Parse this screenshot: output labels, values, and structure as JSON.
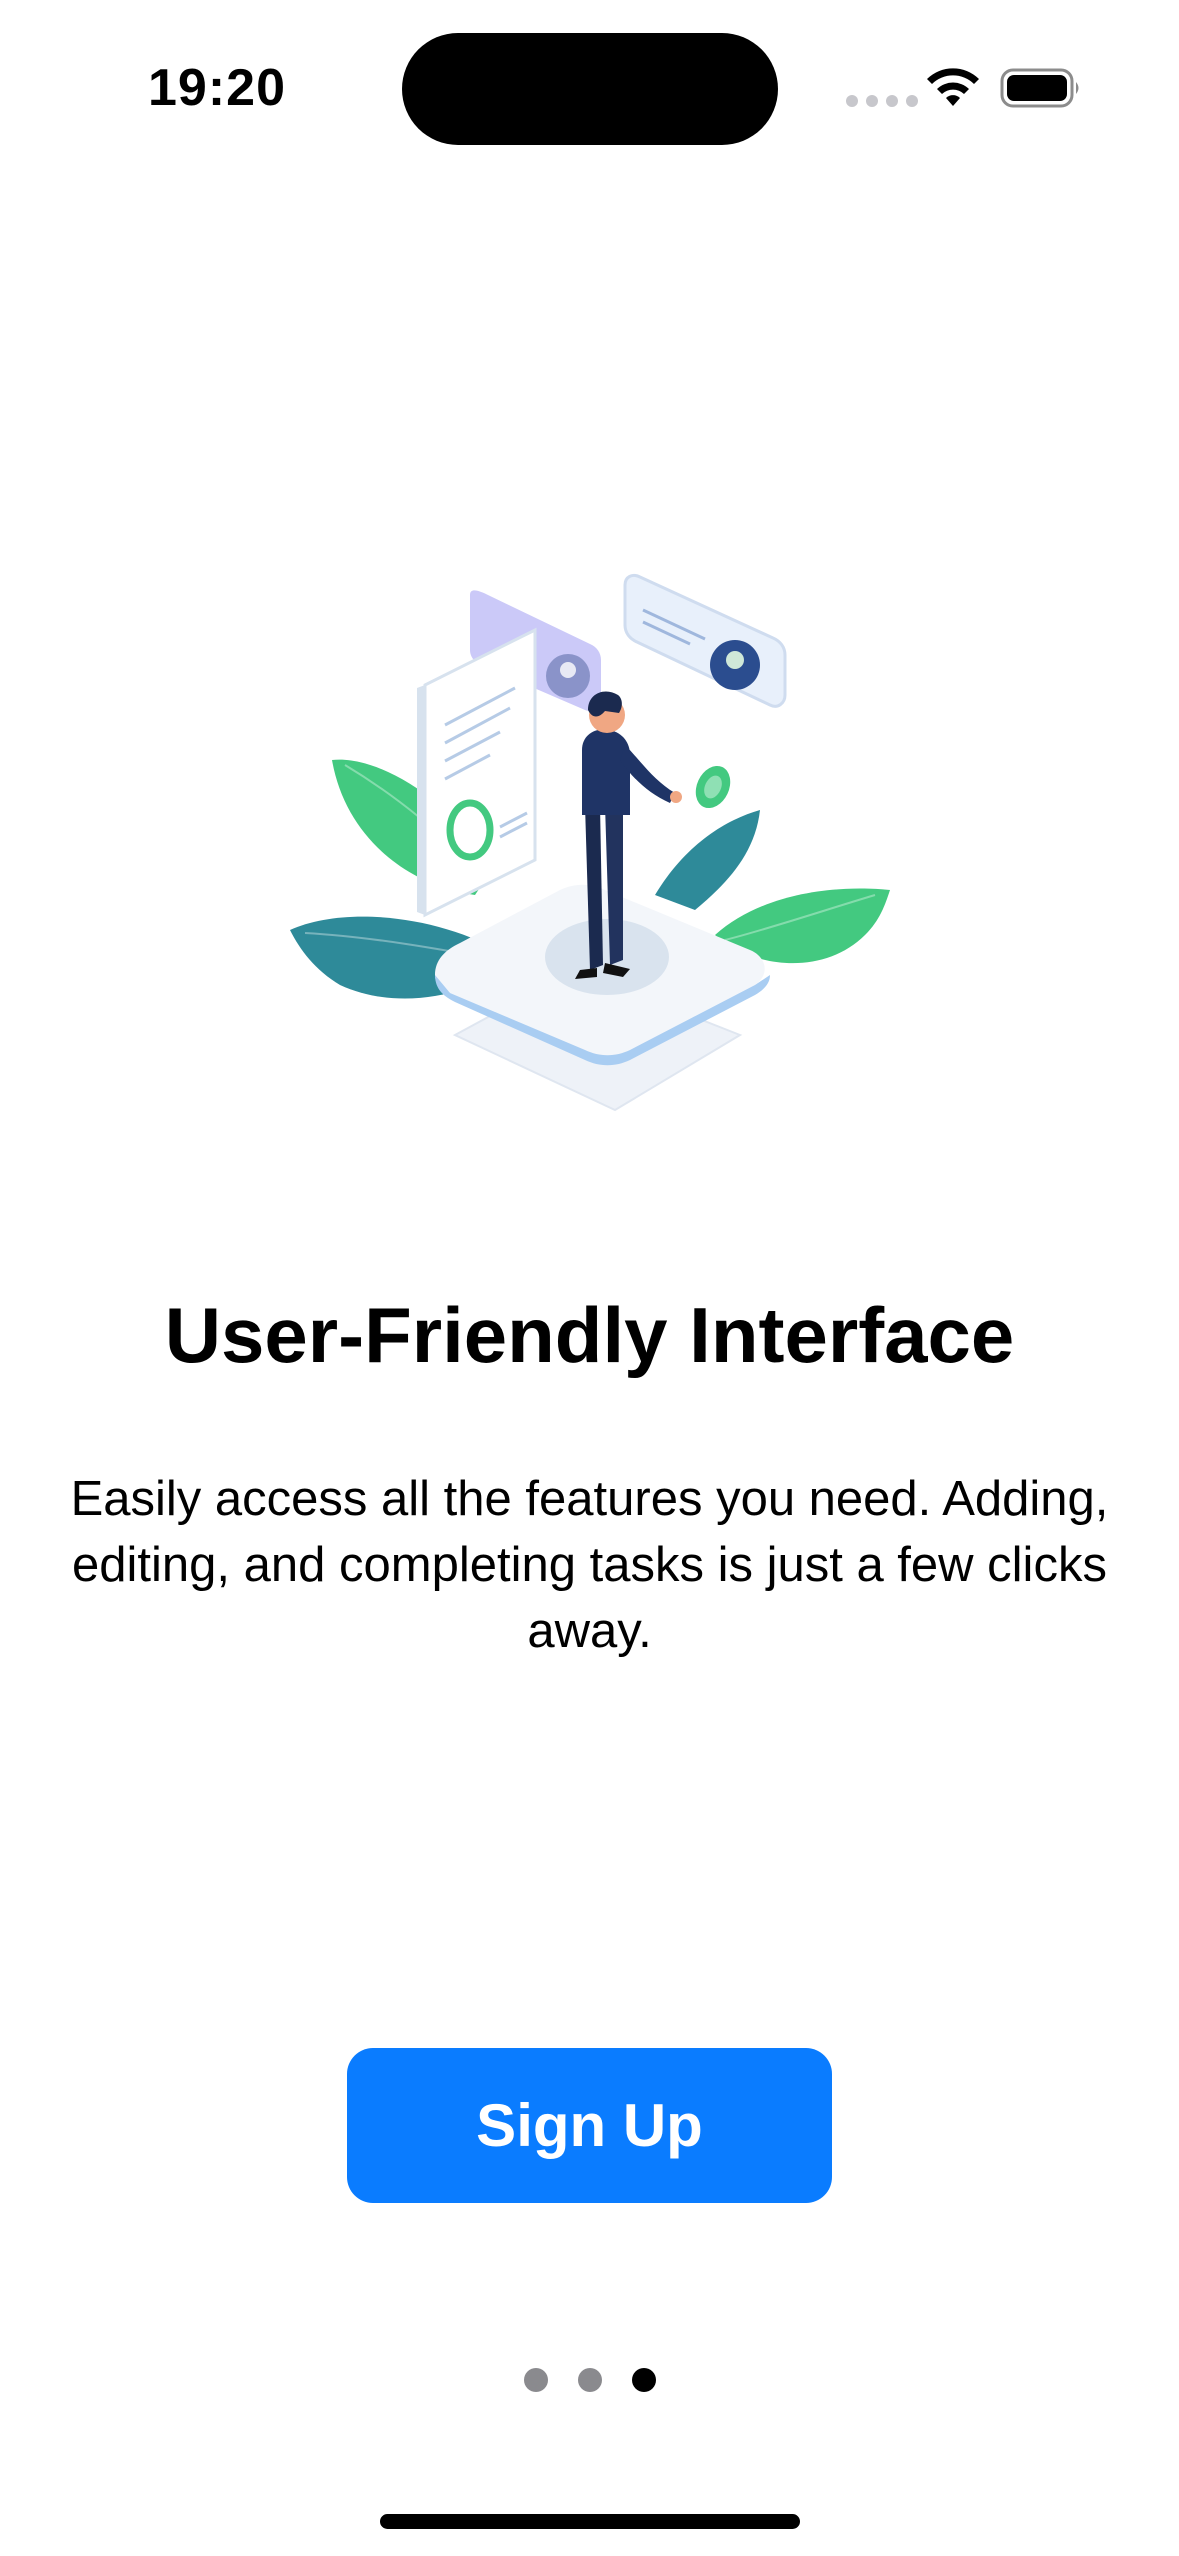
{
  "status_bar": {
    "time": "19:20"
  },
  "icons": {
    "wifi": "wifi-icon",
    "battery": "battery-icon",
    "cellular": "cellular-signal-icon"
  },
  "onboarding": {
    "title": "User-Friendly Interface",
    "description": "Easily access all the features you need. Adding, editing, and completing tasks is just a few clicks away.",
    "button_label": "Sign Up",
    "page_count": 3,
    "current_page": 3
  },
  "colors": {
    "accent": "#0a7cff",
    "leaf_green": "#43c980",
    "leaf_teal": "#2e8a99",
    "suit": "#1f3466"
  }
}
